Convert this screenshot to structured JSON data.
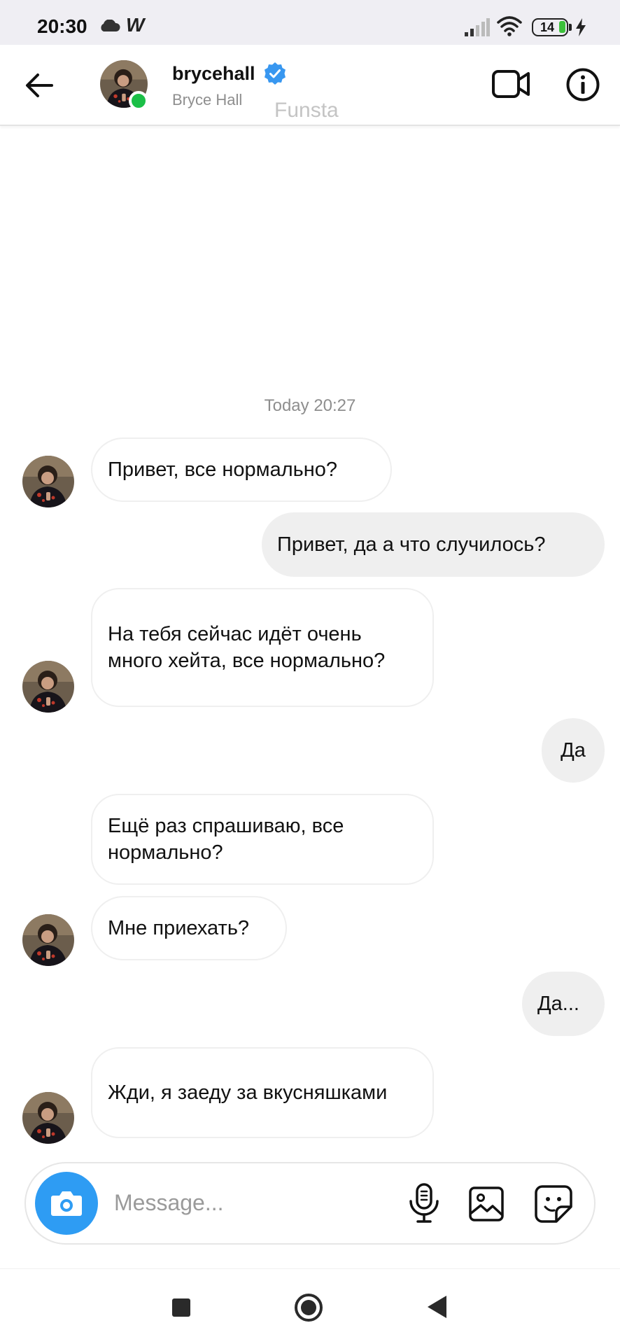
{
  "status_bar": {
    "time": "20:30",
    "app_glyph": "W",
    "battery_level": "14",
    "icons": [
      "cloud-icon",
      "w-app-icon",
      "signal-icon",
      "wifi-icon",
      "battery-icon",
      "charging-icon"
    ]
  },
  "header": {
    "username": "brycehall",
    "full_name": "Bryce Hall",
    "verified": true,
    "online": true,
    "icons": [
      "back-arrow-icon",
      "video-call-icon",
      "info-icon"
    ]
  },
  "watermark": "Funsta",
  "chat": {
    "timestamp": "Today 20:27",
    "messages": [
      {
        "from": "them",
        "text": "Привет, все нормально?"
      },
      {
        "from": "me",
        "text": "Привет, да а что случилось?"
      },
      {
        "from": "them",
        "text": "На тебя сейчас идёт очень много хейта, все нормально?"
      },
      {
        "from": "me",
        "text": "Да"
      },
      {
        "from": "them",
        "text": "Ещё раз спрашиваю, все нормально?"
      },
      {
        "from": "them",
        "text": "Мне приехать?"
      },
      {
        "from": "me",
        "text": "Да..."
      },
      {
        "from": "them",
        "text": "Жди, я заеду за вкусняшками"
      }
    ]
  },
  "composer": {
    "placeholder": "Message...",
    "value": "",
    "icons": [
      "camera-icon",
      "microphone-icon",
      "gallery-icon",
      "sticker-icon"
    ]
  },
  "colors": {
    "accent_blue": "#2e9cf3",
    "verified_blue": "#3897f0",
    "online_green": "#1bbf47",
    "outgoing_bubble": "#efefef",
    "status_bar_bg": "#efeef3"
  },
  "nav_bar": {
    "icons": [
      "recents-icon",
      "home-icon",
      "back-icon"
    ]
  }
}
